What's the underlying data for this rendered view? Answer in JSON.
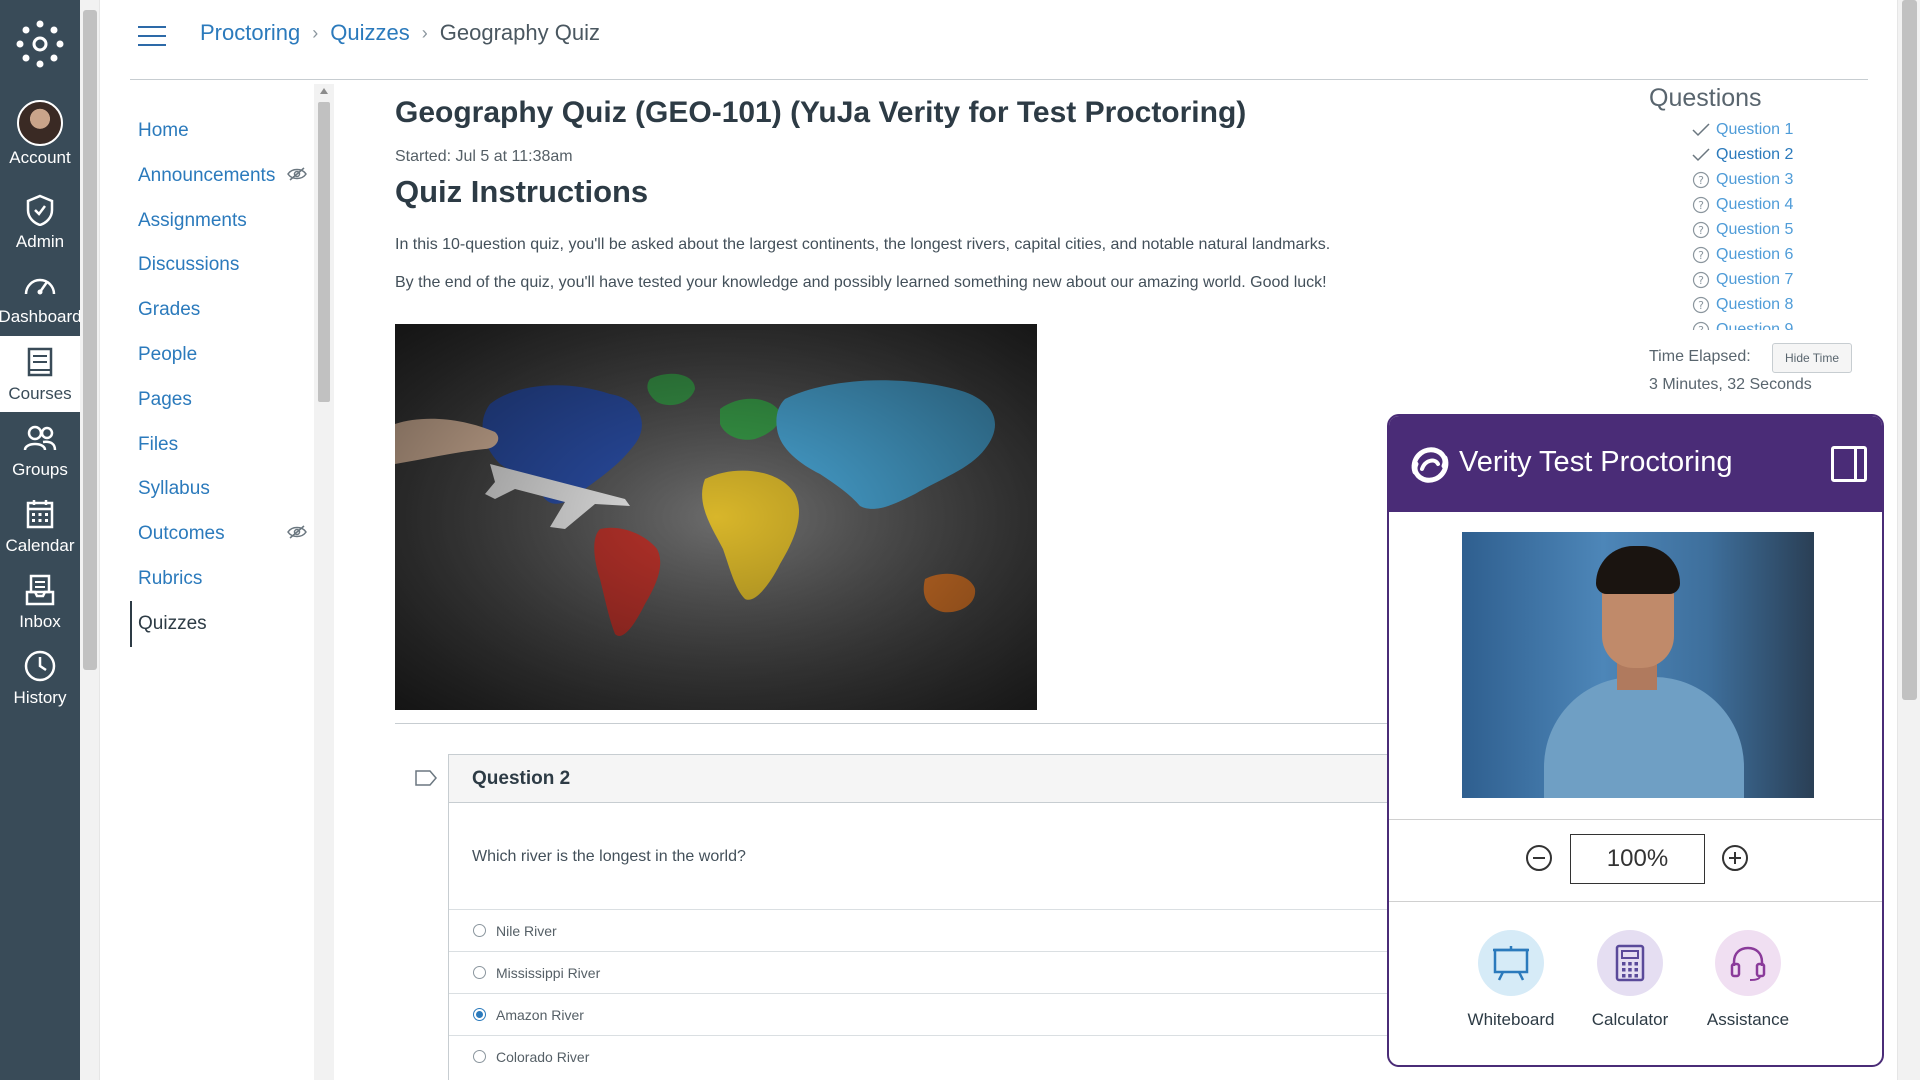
{
  "global_nav": {
    "items": [
      {
        "label": "Account",
        "icon": "avatar"
      },
      {
        "label": "Admin",
        "icon": "shield-icon"
      },
      {
        "label": "Dashboard",
        "icon": "dashboard-icon"
      },
      {
        "label": "Courses",
        "icon": "courses-icon"
      },
      {
        "label": "Groups",
        "icon": "groups-icon"
      },
      {
        "label": "Calendar",
        "icon": "calendar-icon"
      },
      {
        "label": "Inbox",
        "icon": "inbox-icon"
      },
      {
        "label": "History",
        "icon": "history-icon"
      }
    ],
    "colors": {
      "background": "#394b58",
      "active_background": "#ffffff"
    }
  },
  "breadcrumb": {
    "items": [
      "Proctoring",
      "Quizzes",
      "Geography Quiz"
    ],
    "separator": "›"
  },
  "course_nav": {
    "items": [
      "Home",
      "Announcements",
      "Assignments",
      "Discussions",
      "Grades",
      "People",
      "Pages",
      "Files",
      "Syllabus",
      "Outcomes",
      "Rubrics",
      "Quizzes"
    ],
    "active": "Quizzes",
    "hidden_items": [
      "Announcements",
      "Outcomes"
    ]
  },
  "main": {
    "title": "Geography Quiz (GEO-101) (YuJa Verity for Test Proctoring)",
    "started": "Started: Jul 5 at 11:38am",
    "instructions_heading": "Quiz Instructions",
    "instructions": [
      "In this 10-question quiz, you'll be asked about the largest continents, the longest rivers, capital cities, and notable natural landmarks.",
      "By the end of the quiz, you'll have tested your knowledge and possibly learned something new about our amazing world.  Good luck!"
    ],
    "image_alt": "world map painted on chalkboard with toy airplane"
  },
  "question": {
    "title": "Question 2",
    "text": "Which river is the longest in the world?",
    "answers": [
      {
        "label": "Nile River",
        "selected": false
      },
      {
        "label": "Mississippi River",
        "selected": false
      },
      {
        "label": "Amazon River",
        "selected": true
      },
      {
        "label": "Colorado River",
        "selected": false
      }
    ]
  },
  "questions_panel": {
    "heading": "Questions",
    "items": [
      {
        "label": "Question 1",
        "status": "answered"
      },
      {
        "label": "Question 2",
        "status": "answered",
        "current": true
      },
      {
        "label": "Question 3",
        "status": "unanswered"
      },
      {
        "label": "Question 4",
        "status": "unanswered"
      },
      {
        "label": "Question 5",
        "status": "unanswered"
      },
      {
        "label": "Question 6",
        "status": "unanswered"
      },
      {
        "label": "Question 7",
        "status": "unanswered"
      },
      {
        "label": "Question 8",
        "status": "unanswered"
      },
      {
        "label": "Question 9",
        "status": "unanswered"
      }
    ],
    "time_label": "Time Elapsed:",
    "hide_time_label": "Hide Time",
    "time_value": "3 Minutes, 32 Seconds"
  },
  "verity": {
    "title": "Verity Test Proctoring",
    "zoom": "100%",
    "tools": [
      {
        "label": "Whiteboard",
        "icon": "whiteboard-icon",
        "bg": "#d6ebf7",
        "fg": "#2b7abc"
      },
      {
        "label": "Calculator",
        "icon": "calculator-icon",
        "bg": "#e5def2",
        "fg": "#5a4a9a"
      },
      {
        "label": "Assistance",
        "icon": "headset-icon",
        "bg": "#f0dff2",
        "fg": "#8a3a9a"
      }
    ],
    "colors": {
      "header": "#4a2c77"
    }
  }
}
